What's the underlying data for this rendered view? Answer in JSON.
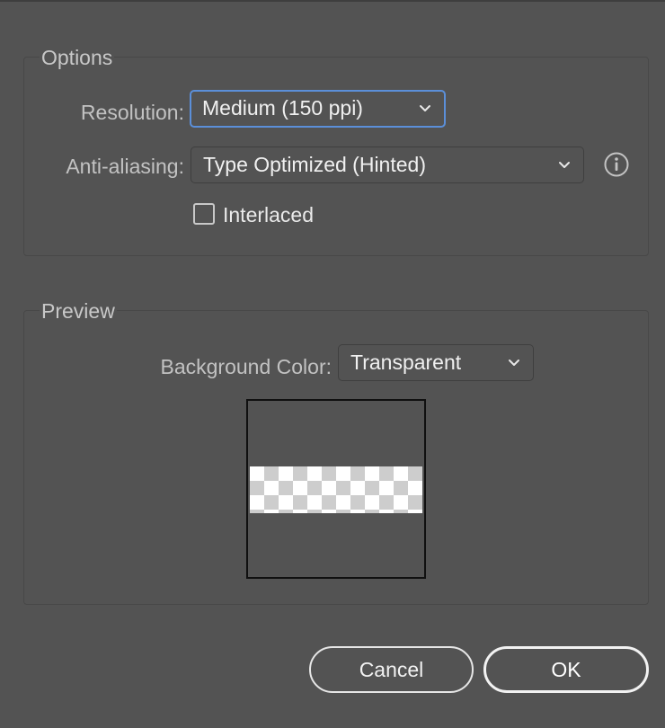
{
  "options": {
    "title": "Options",
    "resolution": {
      "label": "Resolution:",
      "value": "Medium (150 ppi)"
    },
    "antialiasing": {
      "label": "Anti-aliasing:",
      "value": "Type Optimized (Hinted)"
    },
    "interlaced": {
      "label": "Interlaced",
      "checked": false
    }
  },
  "preview": {
    "title": "Preview",
    "background_color": {
      "label": "Background Color:",
      "value": "Transparent"
    }
  },
  "buttons": {
    "cancel": "Cancel",
    "ok": "OK"
  },
  "icons": {
    "info": "info-icon",
    "chevron": "chevron-down-icon"
  },
  "colors": {
    "dialog_bg": "#535353",
    "focus_ring": "#5b8fd9"
  }
}
